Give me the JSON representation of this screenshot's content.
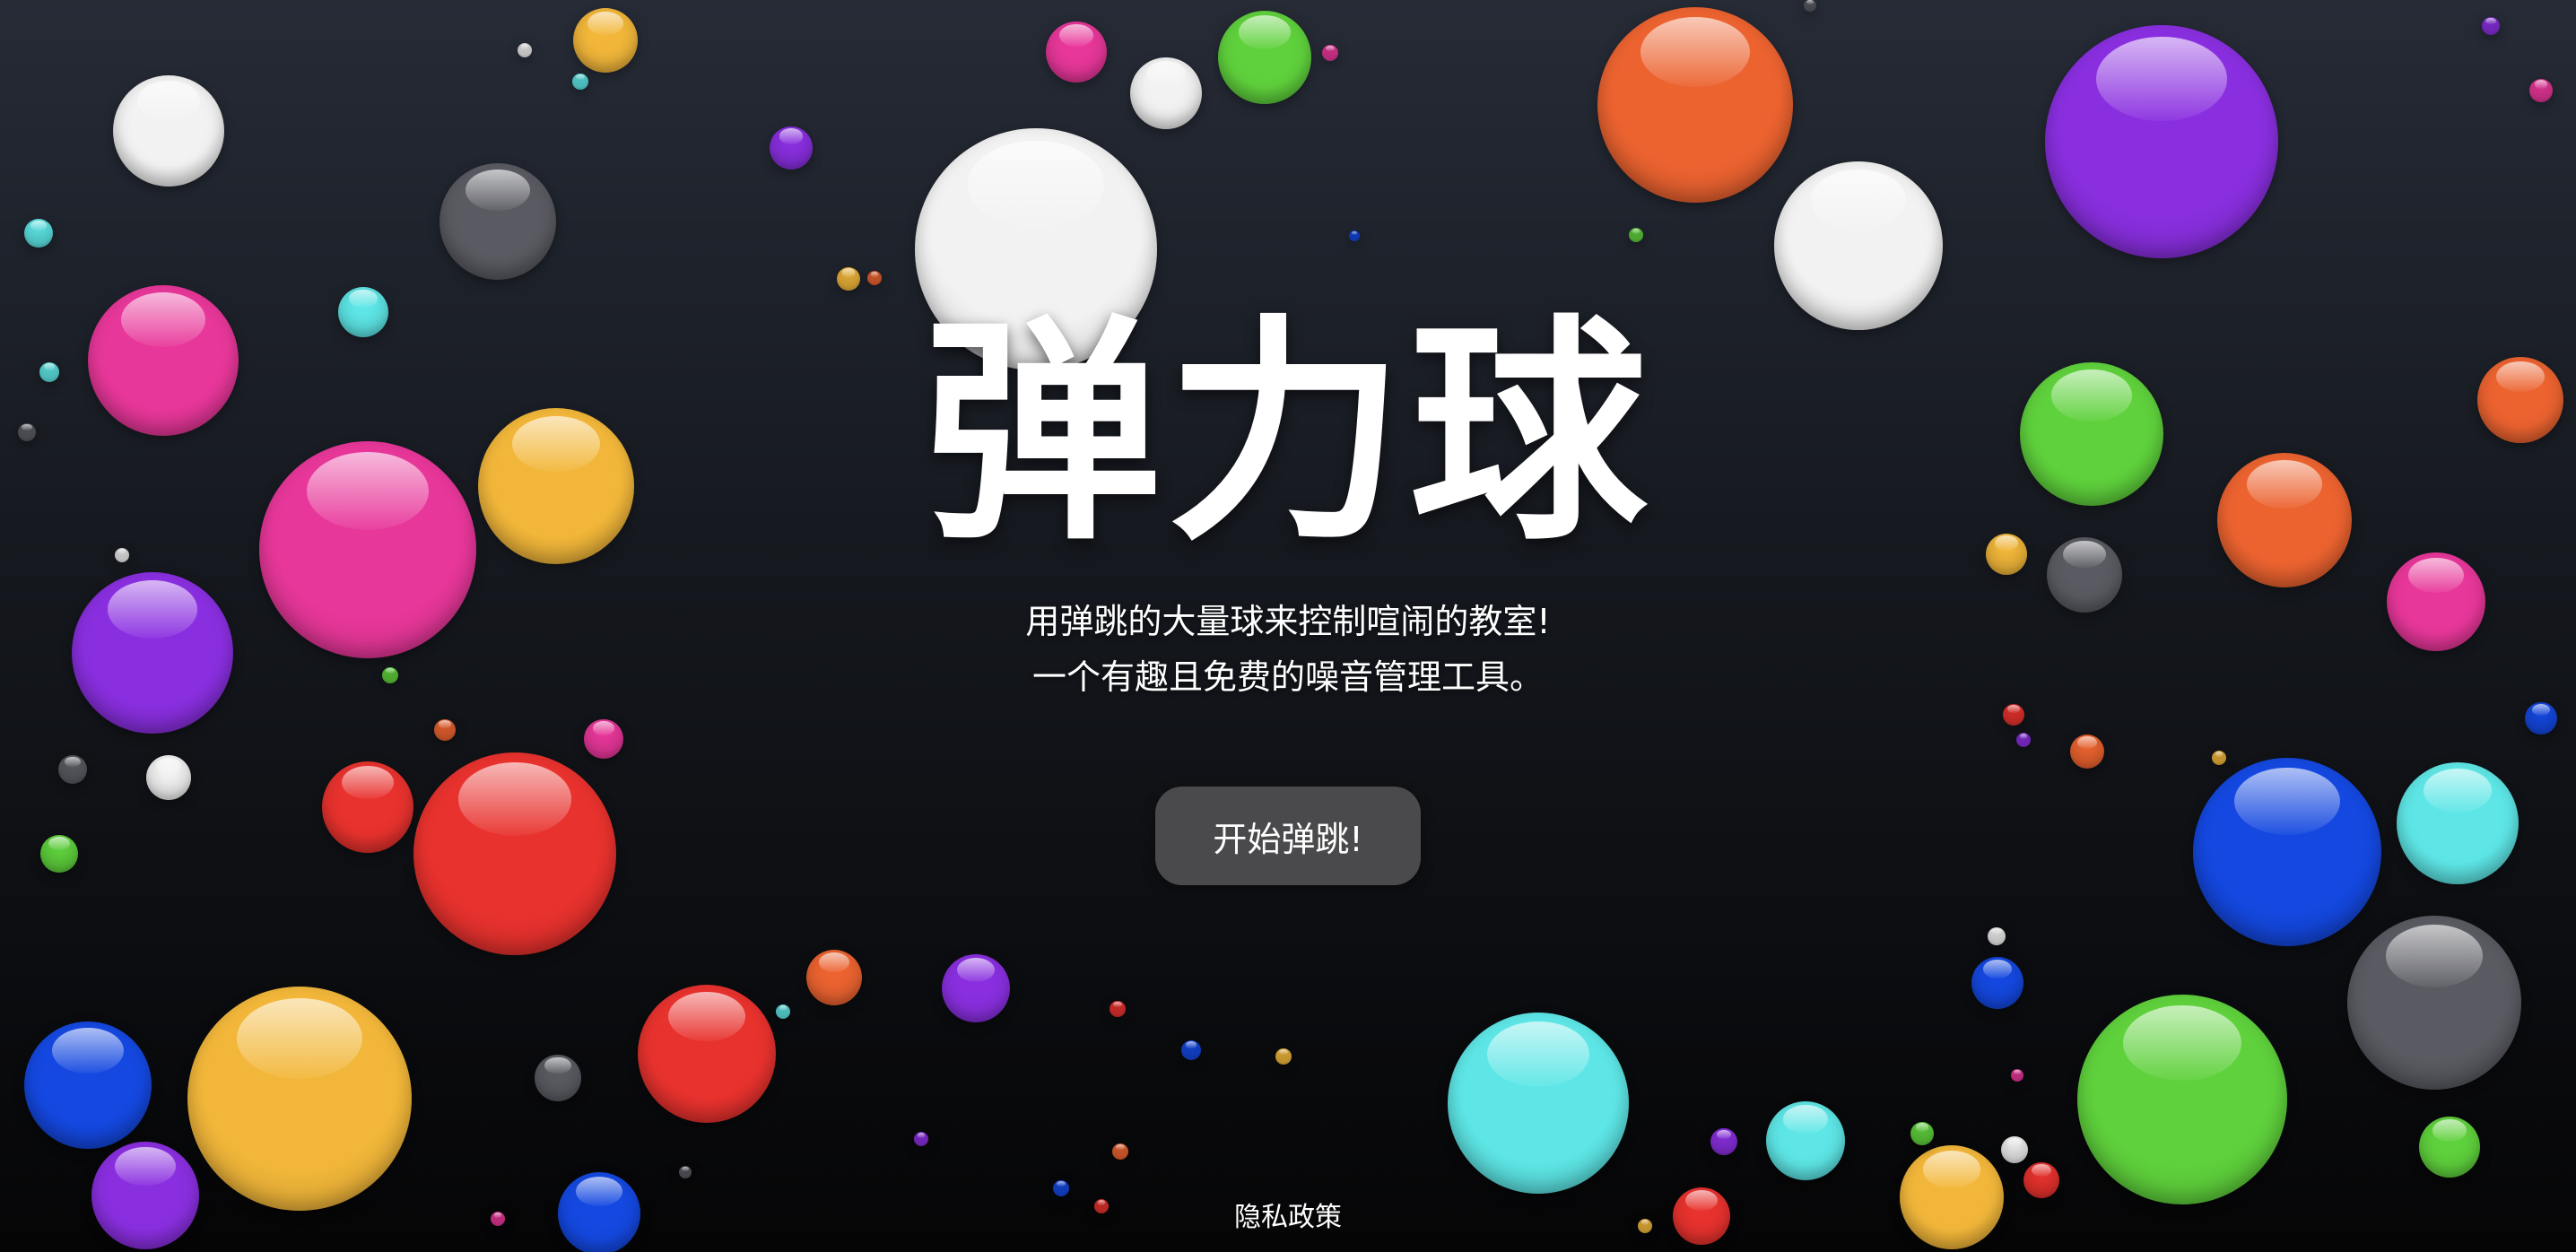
{
  "hero": {
    "title": "弹力球",
    "subtitle_line1": "用弹跳的大量球来控制喧闹的教室!",
    "subtitle_line2": "一个有趣且免费的噪音管理工具。"
  },
  "start_button": {
    "label": "开始弹跳!"
  },
  "footer": {
    "privacy_link": "隐私政策"
  },
  "colors": {
    "background_top": "#262b36",
    "background_bottom": "#050506",
    "button": "#4a4a4c",
    "text": "#ffffff"
  },
  "ball_palette": {
    "white": "#f2f2f2",
    "gray": "#5a5b62",
    "pink": "#e8379a",
    "purple": "#8a2fe0",
    "yellow": "#f2b73a",
    "red": "#e8322e",
    "orange": "#ec6330",
    "green": "#5fd13c",
    "blue": "#1448e0",
    "cyan": "#5ee6e6"
  }
}
